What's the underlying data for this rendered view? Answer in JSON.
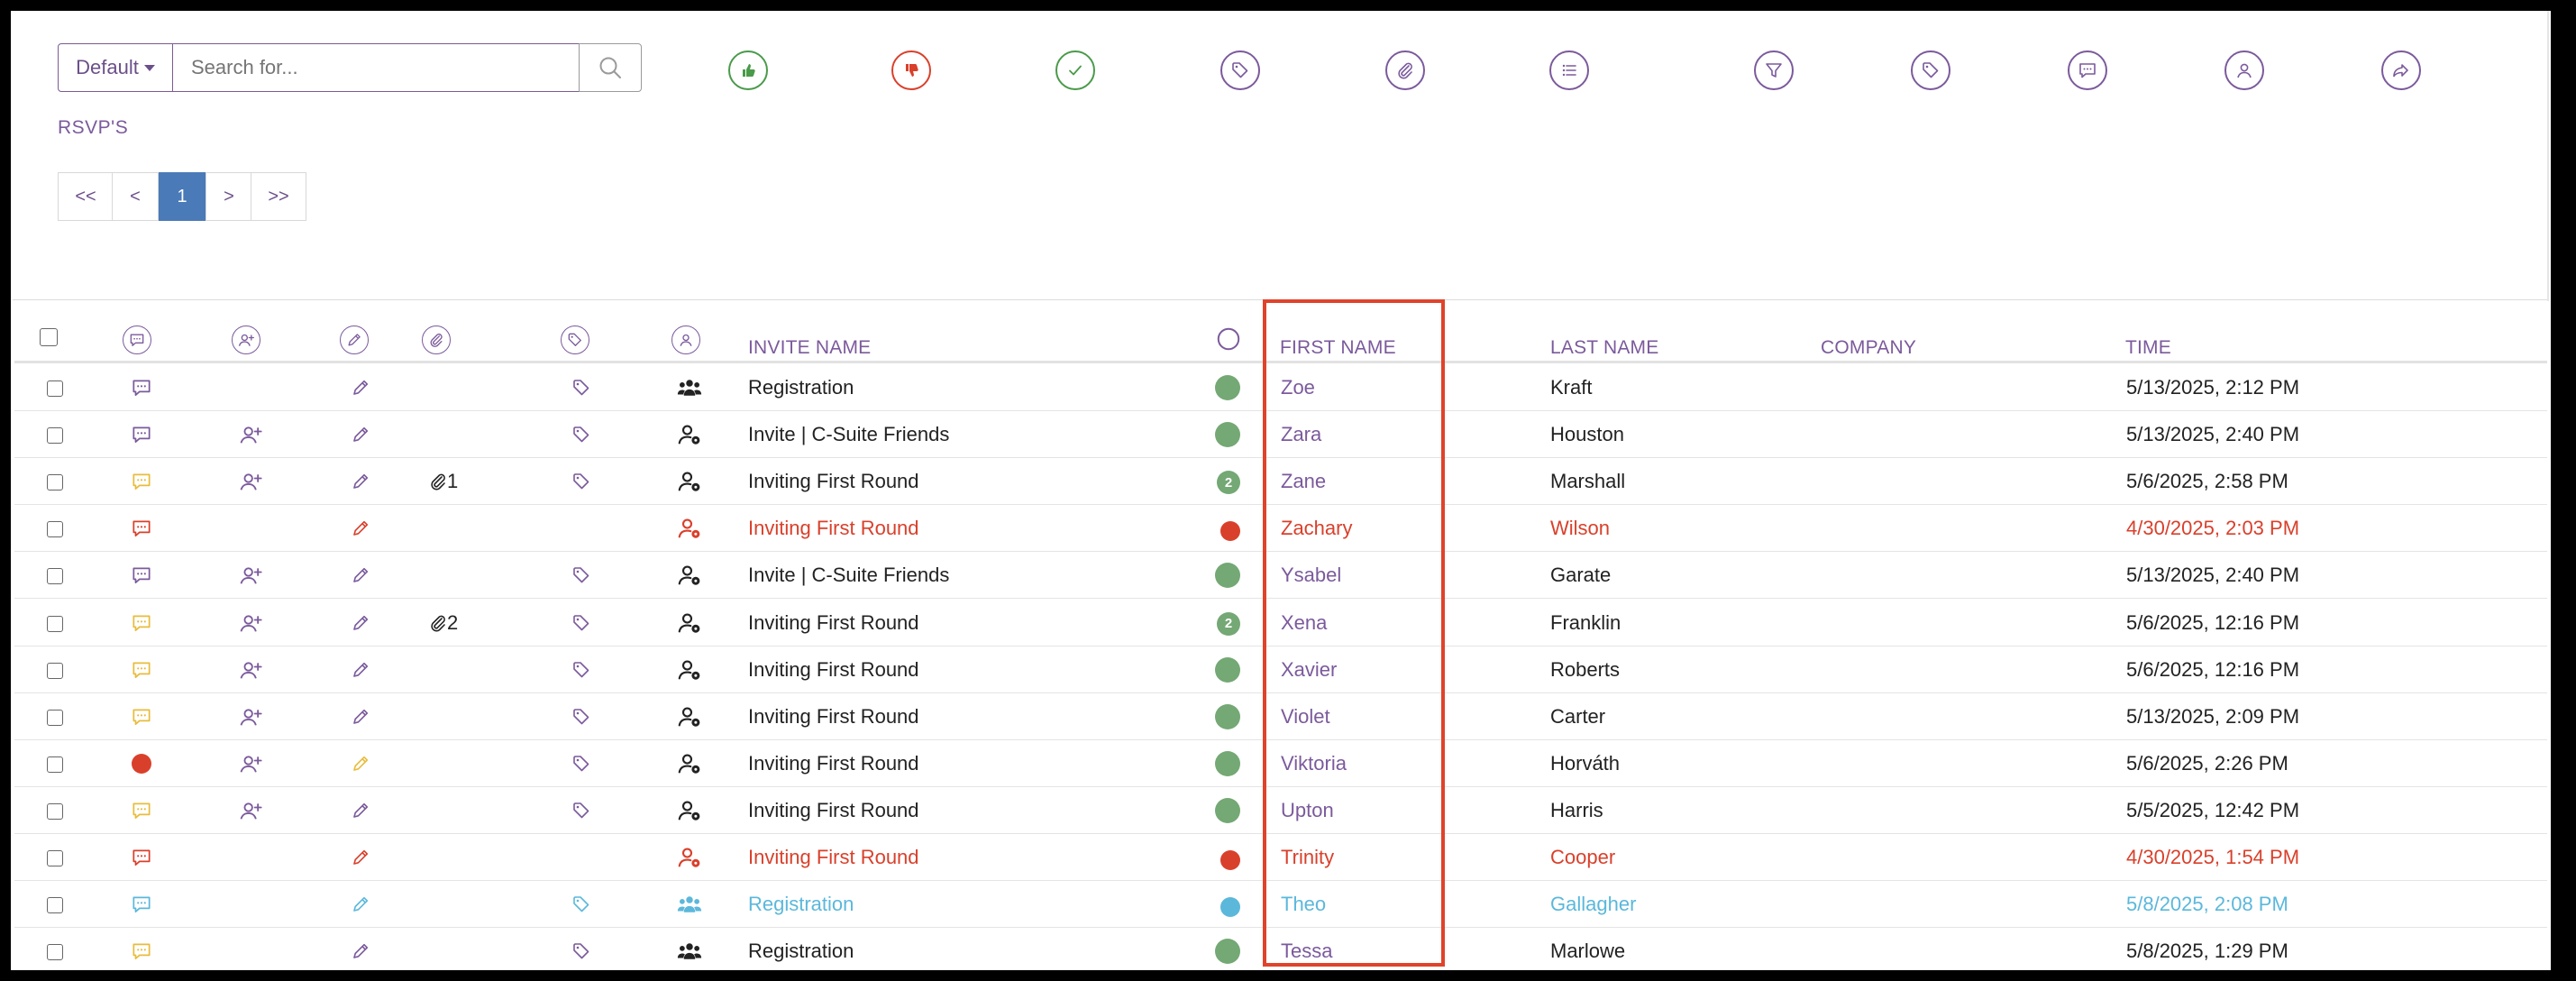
{
  "toolbar": {
    "default_label": "Default",
    "search_placeholder": "Search for...",
    "action_icons": [
      {
        "name": "thumbs-up-icon",
        "color": "#4a9a4a",
        "fill": true
      },
      {
        "name": "thumbs-down-icon",
        "color": "#d9402b",
        "fill": true
      },
      {
        "name": "check-icon",
        "color": "#4a9a4a"
      },
      {
        "name": "tag-icon",
        "color": "#7b5a9c"
      },
      {
        "name": "paperclip-icon",
        "color": "#7b5a9c"
      },
      {
        "name": "list-icon",
        "color": "#7b5a9c"
      },
      {
        "name": "filter-icon",
        "color": "#7b5a9c"
      },
      {
        "name": "tag-icon",
        "color": "#7b5a9c"
      },
      {
        "name": "comment-icon",
        "color": "#7b5a9c"
      },
      {
        "name": "user-icon",
        "color": "#7b5a9c"
      },
      {
        "name": "share-icon",
        "color": "#7b5a9c"
      }
    ]
  },
  "section_title": "RSVP'S",
  "pagination": {
    "first": "<<",
    "prev": "<",
    "current": "1",
    "next": ">",
    "last": ">>"
  },
  "table": {
    "header_icons": [
      "comment-icon",
      "add-user-icon",
      "pencil-icon",
      "paperclip-icon",
      "tag-icon",
      "user-icon",
      "status-circle-icon"
    ],
    "columns": {
      "invite_name": "INVITE NAME",
      "first_name": "FIRST NAME",
      "last_name": "LAST NAME",
      "company": "COMPANY",
      "time": "TIME"
    },
    "colors": {
      "purple": "#7b5a9c",
      "red": "#d9402b",
      "blue": "#5bb8db",
      "green": "#74a874",
      "yellow": "#e8bc3c",
      "dark": "#222222"
    },
    "rows": [
      {
        "comment": "purple",
        "adduser": false,
        "pencil": "purple",
        "clip": "",
        "tag": true,
        "person": "group",
        "invite": "Registration",
        "dot": "green",
        "dot_num": "",
        "first": "Zoe",
        "last": "Kraft",
        "company": "",
        "time": "5/13/2025, 2:12 PM",
        "tone": "normal"
      },
      {
        "comment": "purple",
        "adduser": true,
        "pencil": "purple",
        "clip": "",
        "tag": true,
        "person": "user-cog",
        "invite": "Invite | C-Suite Friends",
        "dot": "green",
        "dot_num": "",
        "first": "Zara",
        "last": "Houston",
        "company": "",
        "time": "5/13/2025, 2:40 PM",
        "tone": "normal"
      },
      {
        "comment": "yellow",
        "adduser": true,
        "pencil": "purple",
        "clip": "1",
        "tag": true,
        "person": "user-cog",
        "invite": "Inviting First Round",
        "dot": "green",
        "dot_num": "2",
        "first": "Zane",
        "last": "Marshall",
        "company": "",
        "time": "5/6/2025, 2:58 PM",
        "tone": "normal"
      },
      {
        "comment": "red",
        "adduser": false,
        "pencil": "red",
        "clip": "",
        "tag": false,
        "person": "user-cog",
        "invite": "Inviting First Round",
        "dot": "red",
        "dot_num": "",
        "first": "Zachary",
        "last": "Wilson",
        "company": "",
        "time": "4/30/2025, 2:03 PM",
        "tone": "red"
      },
      {
        "comment": "purple",
        "adduser": true,
        "pencil": "purple",
        "clip": "",
        "tag": true,
        "person": "user-cog",
        "invite": "Invite | C-Suite Friends",
        "dot": "green",
        "dot_num": "",
        "first": "Ysabel",
        "last": "Garate",
        "company": "",
        "time": "5/13/2025, 2:40 PM",
        "tone": "normal"
      },
      {
        "comment": "yellow",
        "adduser": true,
        "pencil": "purple",
        "clip": "2",
        "tag": true,
        "person": "user-cog",
        "invite": "Inviting First Round",
        "dot": "green",
        "dot_num": "2",
        "first": "Xena",
        "last": "Franklin",
        "company": "",
        "time": "5/6/2025, 12:16 PM",
        "tone": "normal"
      },
      {
        "comment": "yellow",
        "adduser": true,
        "pencil": "purple",
        "clip": "",
        "tag": true,
        "person": "user-cog",
        "invite": "Inviting First Round",
        "dot": "green",
        "dot_num": "",
        "first": "Xavier",
        "last": "Roberts",
        "company": "",
        "time": "5/6/2025, 12:16 PM",
        "tone": "normal"
      },
      {
        "comment": "yellow",
        "adduser": true,
        "pencil": "purple",
        "clip": "",
        "tag": true,
        "person": "user-cog",
        "invite": "Inviting First Round",
        "dot": "green",
        "dot_num": "",
        "first": "Violet",
        "last": "Carter",
        "company": "",
        "time": "5/13/2025, 2:09 PM",
        "tone": "normal"
      },
      {
        "comment": "red-dot",
        "adduser": true,
        "pencil": "yellow",
        "clip": "",
        "tag": true,
        "person": "user-cog",
        "invite": "Inviting First Round",
        "dot": "green",
        "dot_num": "",
        "first": "Viktoria",
        "last": "Horváth",
        "company": "",
        "time": "5/6/2025, 2:26 PM",
        "tone": "normal"
      },
      {
        "comment": "yellow",
        "adduser": true,
        "pencil": "purple",
        "clip": "",
        "tag": true,
        "person": "user-cog",
        "invite": "Inviting First Round",
        "dot": "green",
        "dot_num": "",
        "first": "Upton",
        "last": "Harris",
        "company": "",
        "time": "5/5/2025, 12:42 PM",
        "tone": "normal"
      },
      {
        "comment": "red",
        "adduser": false,
        "pencil": "red",
        "clip": "",
        "tag": false,
        "person": "user-cog",
        "invite": "Inviting First Round",
        "dot": "red",
        "dot_num": "",
        "first": "Trinity",
        "last": "Cooper",
        "company": "",
        "time": "4/30/2025, 1:54 PM",
        "tone": "red"
      },
      {
        "comment": "blue",
        "adduser": false,
        "pencil": "blue",
        "clip": "",
        "tag": true,
        "person": "group",
        "invite": "Registration",
        "dot": "blue",
        "dot_num": "",
        "first": "Theo",
        "last": "Gallagher",
        "company": "",
        "time": "5/8/2025, 2:08 PM",
        "tone": "blue"
      },
      {
        "comment": "yellow",
        "adduser": false,
        "pencil": "purple",
        "clip": "",
        "tag": true,
        "person": "group",
        "invite": "Registration",
        "dot": "green",
        "dot_num": "",
        "first": "Tessa",
        "last": "Marlowe",
        "company": "",
        "time": "5/8/2025, 1:29 PM",
        "tone": "normal"
      }
    ]
  }
}
